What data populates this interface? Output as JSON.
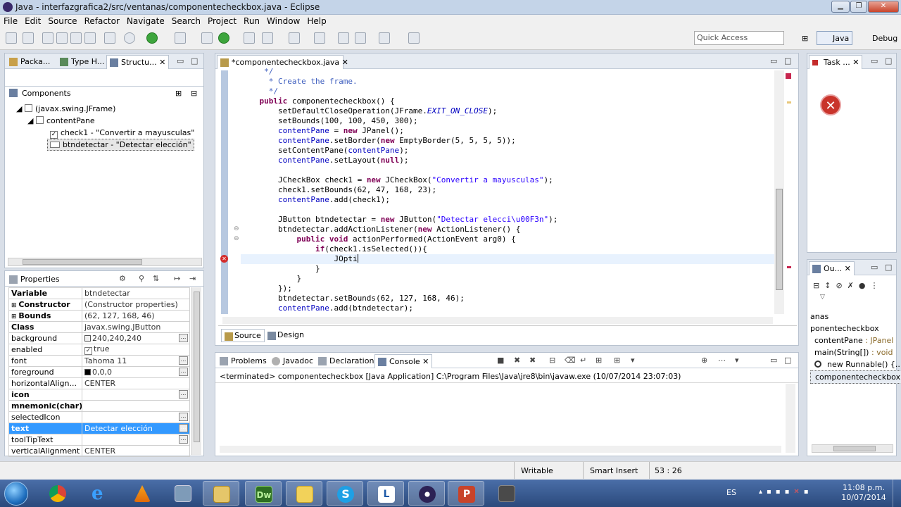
{
  "window": {
    "title": "Java - interfazgrafica2/src/ventanas/componentecheckbox.java - Eclipse"
  },
  "menu": [
    "File",
    "Edit",
    "Source",
    "Refactor",
    "Navigate",
    "Search",
    "Project",
    "Run",
    "Window",
    "Help"
  ],
  "toolbar": {
    "quick_access": "Quick Access"
  },
  "perspectives": {
    "java": "Java",
    "debug": "Debug"
  },
  "left_tabs": [
    "Packa...",
    "Type H...",
    "Structu..."
  ],
  "components": {
    "header": "Components",
    "items": [
      "(javax.swing.JFrame)",
      "contentPane",
      "check1 - \"Convertir a mayusculas\"",
      "btndetectar - \"Detectar elección\""
    ]
  },
  "properties": {
    "header": "Properties",
    "rows": [
      {
        "name": "Variable",
        "value": "btndetectar",
        "bold": true
      },
      {
        "name": "Constructor",
        "value": "(Constructor properties)",
        "bold": true,
        "expand": "+"
      },
      {
        "name": "Bounds",
        "value": "(62, 127, 168, 46)",
        "bold": true,
        "expand": "+"
      },
      {
        "name": "Class",
        "value": "javax.swing.JButton",
        "bold": true
      },
      {
        "name": "background",
        "value": "240,240,240",
        "swatch": "#f0f0f0",
        "btn": true
      },
      {
        "name": "enabled",
        "value": "true",
        "check": true
      },
      {
        "name": "font",
        "value": "Tahoma 11",
        "btn": true
      },
      {
        "name": "foreground",
        "value": "0,0,0",
        "swatch": "#000000",
        "btn": true
      },
      {
        "name": "horizontalAlign...",
        "value": "CENTER"
      },
      {
        "name": "icon",
        "value": "",
        "bold": true,
        "btn": true
      },
      {
        "name": "mnemonic(char)",
        "value": "",
        "bold": true
      },
      {
        "name": "selectedIcon",
        "value": "",
        "btn": true
      },
      {
        "name": "text",
        "value": "Detectar elección",
        "bold": true,
        "selected": true,
        "btn": true
      },
      {
        "name": "toolTipText",
        "value": "",
        "btn": true
      },
      {
        "name": "verticalAlignment",
        "value": "CENTER"
      }
    ]
  },
  "editor": {
    "tab": "*componentecheckbox.java",
    "bottom_tabs": [
      "Source",
      "Design"
    ],
    "lines": [
      [
        [
          "cm",
          "     */"
        ]
      ],
      [
        [
          "cm",
          "      * Create the frame."
        ]
      ],
      [
        [
          "cm",
          "      */"
        ]
      ],
      [
        [
          "",
          "    "
        ],
        [
          "kw",
          "public"
        ],
        [
          "",
          " componentecheckbox() {"
        ]
      ],
      [
        [
          "",
          "        setDefaultCloseOperation(JFrame."
        ],
        [
          "it",
          "EXIT_ON_CLOSE"
        ],
        [
          "",
          ");"
        ]
      ],
      [
        [
          "",
          "        setBounds(100, 100, 450, 300);"
        ]
      ],
      [
        [
          "",
          "        "
        ],
        [
          "fld",
          "contentPane"
        ],
        [
          "",
          " = "
        ],
        [
          "kw",
          "new"
        ],
        [
          "",
          " JPanel();"
        ]
      ],
      [
        [
          "",
          "        "
        ],
        [
          "fld",
          "contentPane"
        ],
        [
          "",
          ".setBorder("
        ],
        [
          "kw",
          "new"
        ],
        [
          "",
          " EmptyBorder(5, 5, 5, 5));"
        ]
      ],
      [
        [
          "",
          "        setContentPane("
        ],
        [
          "fld",
          "contentPane"
        ],
        [
          "",
          ");"
        ]
      ],
      [
        [
          "",
          "        "
        ],
        [
          "fld",
          "contentPane"
        ],
        [
          "",
          ".setLayout("
        ],
        [
          "kw",
          "null"
        ],
        [
          "",
          ");"
        ]
      ],
      [
        [
          "",
          ""
        ]
      ],
      [
        [
          "",
          "        JCheckBox check1 = "
        ],
        [
          "kw",
          "new"
        ],
        [
          "",
          " JCheckBox("
        ],
        [
          "st",
          "\"Convertir a mayusculas\""
        ],
        [
          "",
          ");"
        ]
      ],
      [
        [
          "",
          "        check1.setBounds(62, 47, 168, 23);"
        ]
      ],
      [
        [
          "",
          "        "
        ],
        [
          "fld",
          "contentPane"
        ],
        [
          "",
          ".add(check1);"
        ]
      ],
      [
        [
          "",
          ""
        ]
      ],
      [
        [
          "",
          "        JButton btndetectar = "
        ],
        [
          "kw",
          "new"
        ],
        [
          "",
          " JButton("
        ],
        [
          "st",
          "\"Detectar elecci\\u00F3n\""
        ],
        [
          "",
          ");"
        ]
      ],
      [
        [
          "",
          "        btndetectar.addActionListener("
        ],
        [
          "kw",
          "new"
        ],
        [
          "",
          " ActionListener() {"
        ]
      ],
      [
        [
          "",
          "            "
        ],
        [
          "kw",
          "public"
        ],
        [
          "",
          " "
        ],
        [
          "kw",
          "void"
        ],
        [
          "",
          " actionPerformed(ActionEvent arg0) {"
        ]
      ],
      [
        [
          "",
          "                "
        ],
        [
          "kw",
          "if"
        ],
        [
          "",
          "(check1.isSelected()){"
        ]
      ],
      [
        [
          "",
          "                    JOpti"
        ]
      ],
      [
        [
          "",
          "                }"
        ]
      ],
      [
        [
          "",
          "            }"
        ]
      ],
      [
        [
          "",
          "        });"
        ]
      ],
      [
        [
          "",
          "        btndetectar.setBounds(62, 127, 168, 46);"
        ]
      ],
      [
        [
          "",
          "        "
        ],
        [
          "fld",
          "contentPane"
        ],
        [
          "",
          ".add(btndetectar);"
        ]
      ]
    ]
  },
  "right_top": {
    "tab": "Task ..."
  },
  "outline": {
    "tab": "Ou...",
    "items": [
      "anas",
      "ponentecheckbox",
      "contentPane",
      "main(String[])",
      "new Runnable() {...}",
      "componentecheckbox()"
    ],
    "suffix": {
      "contentPane": " : JPanel",
      "main": " : void"
    }
  },
  "console": {
    "tabs": [
      "Problems",
      "Javadoc",
      "Declaration",
      "Console"
    ],
    "terminated": "<terminated> componentecheckbox [Java Application] C:\\Program Files\\Java\\jre8\\bin\\javaw.exe (10/07/2014 23:07:03)"
  },
  "status": {
    "writable": "Writable",
    "insert": "Smart Insert",
    "position": "53 : 26"
  },
  "taskbar": {
    "lang": "ES",
    "time": "11:08 p.m.",
    "date": "10/07/2014"
  },
  "colors": {
    "accent": "#3399ff",
    "keyword": "#7f0055",
    "field": "#0000c0",
    "string": "#2a00ff"
  }
}
